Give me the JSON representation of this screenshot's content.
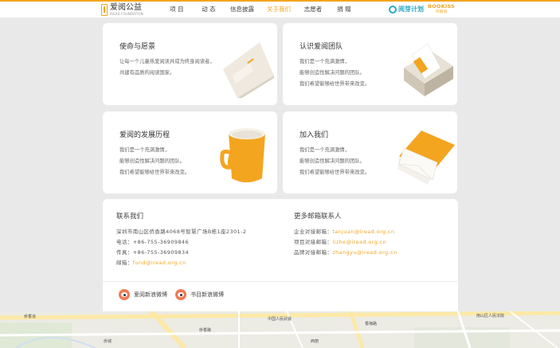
{
  "header": {
    "logo_cn": "爱阅公益",
    "logo_en": "IREAD FOUNDATION",
    "nav": [
      "项 目",
      "动 态",
      "信息披露",
      "关于我们",
      "志愿者",
      "捐 赠"
    ],
    "active_nav": "关于我们",
    "partner1": "阅芽计划",
    "partner2_en": "BOOKISS",
    "partner2_cn": "书目谷"
  },
  "cards": [
    {
      "title": "使命与愿景",
      "lines": [
        "让每一个儿童热爱阅读并成为终身阅读者，",
        "共建有品质的阅读国家。"
      ]
    },
    {
      "title": "认识爱阅团队",
      "lines": [
        "我们是一个充满激情，",
        "能够创造性解决问题的团队。",
        "我们希望能够给世界带来改变。"
      ]
    },
    {
      "title": "爱阅的发展历程",
      "lines": [
        "我们是一个充满激情，",
        "能够创造性解决问题的团队。",
        "我们希望能够给世界带来改变。"
      ]
    },
    {
      "title": "加入我们",
      "lines": [
        "我们是一个充满激情，",
        "能够创造性解决问题的团队。",
        "我们希望能够给世界带来改变。"
      ]
    }
  ],
  "contact": {
    "title": "联系我们",
    "address": "深圳市南山区侨香路4068号智慧广场B栋1座2301-2",
    "phone_label": "电话：",
    "phone": "+86-755-36909846",
    "fax_label": "传真：",
    "fax": "+86-755-36909834",
    "email_label": "邮箱：",
    "email": "fund@iread.org.cn"
  },
  "more_contacts": {
    "title": "更多邮箱联系人",
    "items": [
      {
        "label": "企业对接邮箱：",
        "email": "tanjuan@iread.org.cn"
      },
      {
        "label": "项目对接邮箱：",
        "email": "lizhe@iread.org.cn"
      },
      {
        "label": "品牌对接邮箱：",
        "email": "zhangyu@iread.org.cn"
      }
    ]
  },
  "weibo": {
    "iread": "爱阅新浪微博",
    "shumu": "书目新浪微博"
  },
  "map": {
    "labels": [
      "侨香道",
      "中国人民武装",
      "侨香路",
      "香梅路",
      "侨城",
      "西丽",
      "南山区人民法院"
    ]
  },
  "colors": {
    "accent": "#f3a51f",
    "teal": "#2aa9c2",
    "weibo": "#ef7b55"
  }
}
